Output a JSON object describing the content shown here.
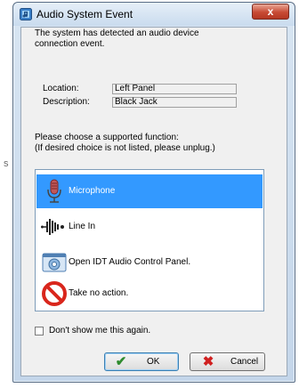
{
  "window": {
    "title": "Audio System Event",
    "close_label": "x"
  },
  "intro": {
    "text": "The system has detected an audio device connection event."
  },
  "info": {
    "location_label": "Location:",
    "location_value": "Left Panel",
    "description_label": "Description:",
    "description_value": "Black Jack"
  },
  "prompt": {
    "line1": "Please choose a supported function:",
    "line2": "(If desired choice is not listed, please unplug.)"
  },
  "options": [
    {
      "label": "Microphone",
      "icon": "microphone-icon",
      "selected": true
    },
    {
      "label": "Line In",
      "icon": "line-in-icon",
      "selected": false
    },
    {
      "label": "Open IDT Audio Control Panel.",
      "icon": "control-panel-icon",
      "selected": false
    },
    {
      "label": "Take no action.",
      "icon": "no-action-icon",
      "selected": false
    }
  ],
  "checkbox": {
    "label": "Don't show me this again.",
    "checked": false
  },
  "buttons": {
    "ok_label": "OK",
    "cancel_label": "Cancel"
  },
  "colors": {
    "selection": "#3399ff",
    "close": "#c84a34"
  }
}
